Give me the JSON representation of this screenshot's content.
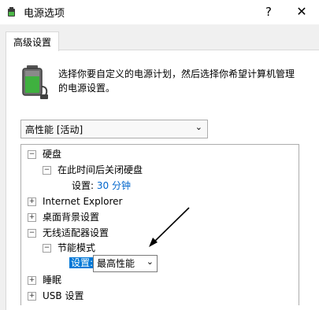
{
  "window": {
    "title": "电源选项",
    "help_symbol": "?",
    "close_symbol": "✕"
  },
  "tabs": [
    {
      "label": "高级设置"
    }
  ],
  "description": "选择你要自定义的电源计划，然后选择你希望计算机管理的电源设置。",
  "plan_select": {
    "value": "高性能 [活动]"
  },
  "tree": {
    "hard_disk": "硬盘",
    "turn_off_disk": "在此时间后关闭硬盘",
    "setting_label": "设置:",
    "disk_value": "30 分钟",
    "ie": "Internet Explorer",
    "desktop_bg": "桌面背景设置",
    "wireless": "无线适配器设置",
    "power_saving_mode": "节能模式",
    "power_saving_setting_label": "设置:",
    "power_saving_value": "最高性能",
    "sleep": "睡眠",
    "usb": "USB 设置"
  },
  "icons": {
    "app": "power-options-icon",
    "battery": "battery-plug-icon"
  },
  "colors": {
    "link": "#0066cc",
    "highlight": "#0078d7"
  }
}
